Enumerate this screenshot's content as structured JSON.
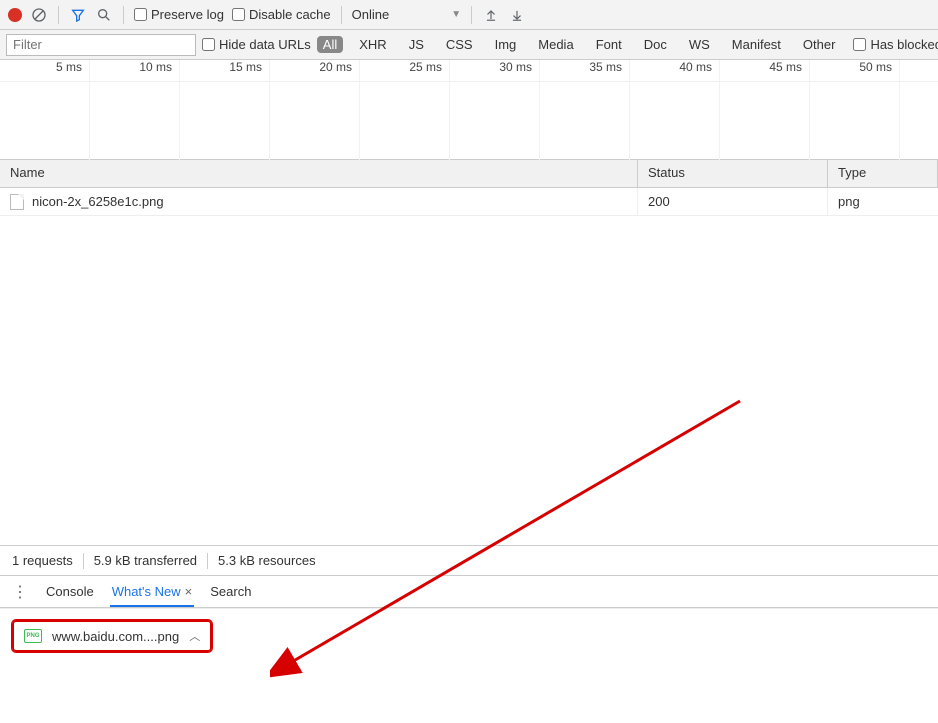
{
  "toolbar": {
    "preserve_log_label": "Preserve log",
    "disable_cache_label": "Disable cache",
    "throttling_label": "Online"
  },
  "filter_bar": {
    "filter_placeholder": "Filter",
    "hide_data_urls_label": "Hide data URLs",
    "types": {
      "all": "All",
      "xhr": "XHR",
      "js": "JS",
      "css": "CSS",
      "img": "Img",
      "media": "Media",
      "font": "Font",
      "doc": "Doc",
      "ws": "WS",
      "manifest": "Manifest",
      "other": "Other"
    },
    "has_blocked_label": "Has blocked"
  },
  "timeline_ticks": [
    "5 ms",
    "10 ms",
    "15 ms",
    "20 ms",
    "25 ms",
    "30 ms",
    "35 ms",
    "40 ms",
    "45 ms",
    "50 ms"
  ],
  "columns": {
    "name": "Name",
    "status": "Status",
    "type": "Type"
  },
  "rows": [
    {
      "name": "nicon-2x_6258e1c.png",
      "status": "200",
      "type": "png"
    }
  ],
  "status_bar": {
    "requests": "1 requests",
    "transferred": "5.9 kB transferred",
    "resources": "5.3 kB resources"
  },
  "drawer": {
    "console": "Console",
    "whats_new": "What's New",
    "search": "Search"
  },
  "download": {
    "filename": "www.baidu.com....png"
  }
}
